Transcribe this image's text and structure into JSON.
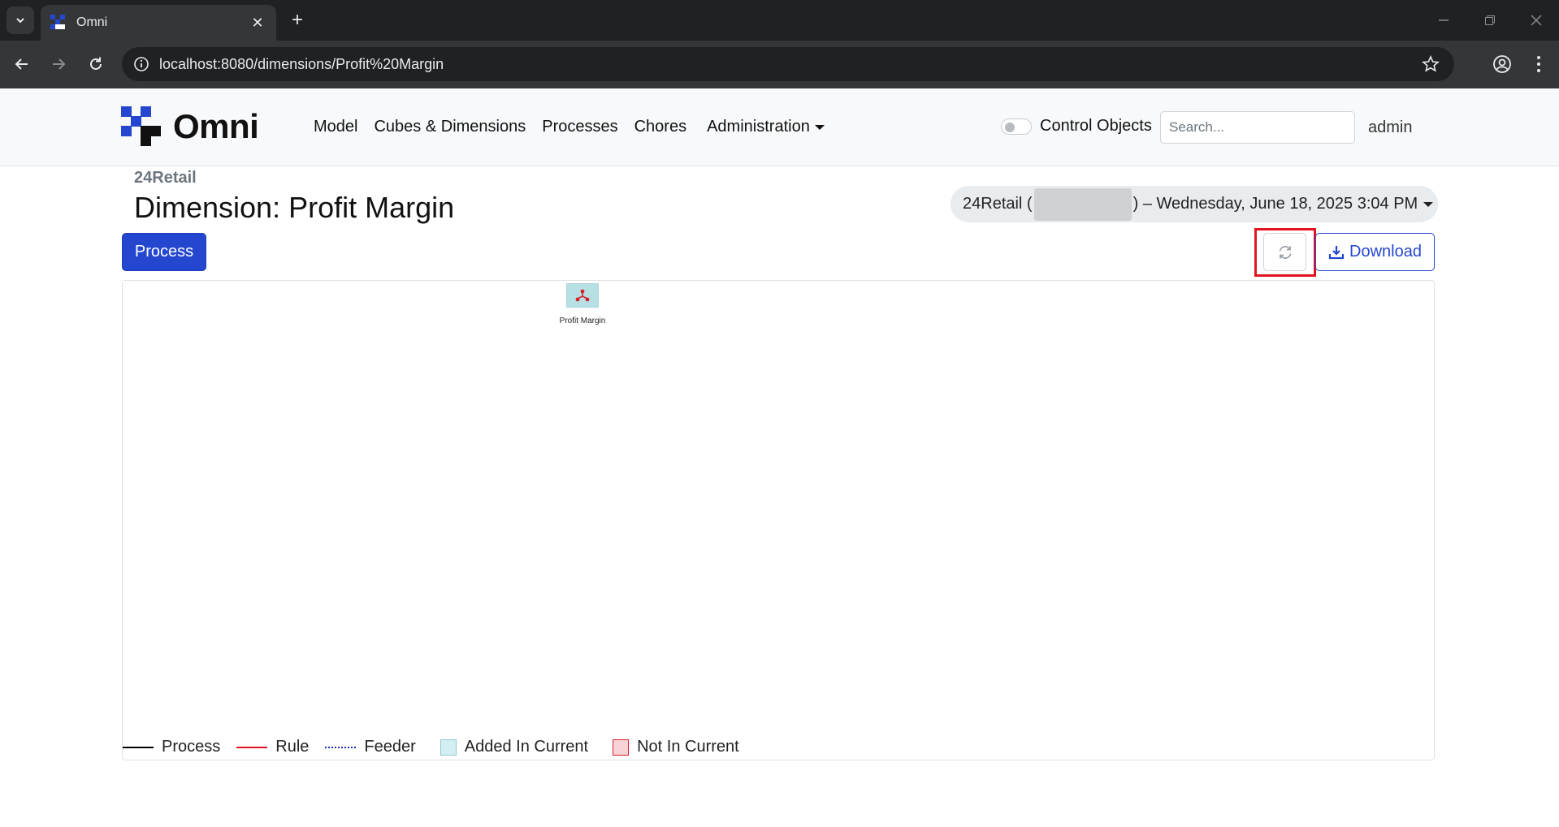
{
  "browser": {
    "tab_title": "Omni",
    "url": "localhost:8080/dimensions/Profit%20Margin"
  },
  "navbar": {
    "brand": "Omni",
    "links": [
      "Model",
      "Cubes & Dimensions",
      "Processes",
      "Chores"
    ],
    "admin_menu": "Administration",
    "control_objects_label": "Control Objects",
    "control_objects_enabled": false,
    "search_placeholder": "Search...",
    "user": "admin"
  },
  "page": {
    "breadcrumb": "24Retail",
    "title": "Dimension: Profit Margin",
    "snapshot_prefix": "24Retail (",
    "snapshot_suffix": ") – Wednesday, June 18, 2025 3:04 PM"
  },
  "actions": {
    "process_label": "Process",
    "download_label": "Download",
    "refresh_icon": "refresh-icon"
  },
  "diagram": {
    "nodes": [
      {
        "label": "Profit Margin",
        "icon": "dimension-hierarchy-icon",
        "color": "#b7e0e5"
      }
    ],
    "legend": [
      {
        "label": "Process",
        "style": "solid",
        "color": "#000000"
      },
      {
        "label": "Rule",
        "style": "solid",
        "color": "#e0141e"
      },
      {
        "label": "Feeder",
        "style": "dotted",
        "color": "#1a2cc8"
      },
      {
        "label": "Added In Current",
        "style": "box",
        "color": "#d3eef2"
      },
      {
        "label": "Not In Current",
        "style": "box",
        "color": "#f7d2d6"
      }
    ]
  },
  "colors": {
    "accent": "#2547d0",
    "highlight": "#e0141e"
  }
}
